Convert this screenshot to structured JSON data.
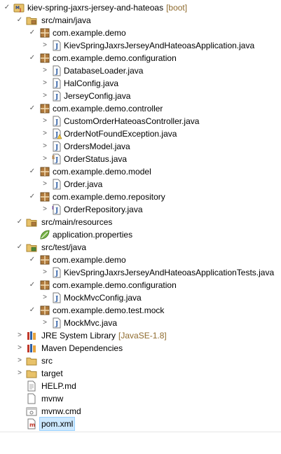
{
  "explorer": {
    "project_name": "kiev-spring-jaxrs-jersey-and-hateoas",
    "project_decoration": "[boot]",
    "src_main_java": "src/main/java",
    "pkg_demo": "com.example.demo",
    "file_app": "KievSpringJaxrsJerseyAndHateoasApplication.java",
    "pkg_configuration": "com.example.demo.configuration",
    "file_database_loader": "DatabaseLoader.java",
    "file_hal_config": "HalConfig.java",
    "file_jersey_config": "JerseyConfig.java",
    "pkg_controller": "com.example.demo.controller",
    "file_custom_controller": "CustomOrderHateoasController.java",
    "file_not_found_exception": "OrderNotFoundException.java",
    "file_orders_model": "OrdersModel.java",
    "file_order_status": "OrderStatus.java",
    "pkg_model": "com.example.demo.model",
    "file_order": "Order.java",
    "pkg_repository": "com.example.demo.repository",
    "file_order_repository": "OrderRepository.java",
    "src_main_resources": "src/main/resources",
    "file_app_properties": "application.properties",
    "src_test_java": "src/test/java",
    "test_pkg_demo": "com.example.demo",
    "file_app_tests": "KievSpringJaxrsJerseyAndHateoasApplicationTests.java",
    "test_pkg_configuration": "com.example.demo.configuration",
    "file_mockmvc_config": "MockMvcConfig.java",
    "test_pkg_mock": "com.example.demo.test.mock",
    "file_mockmvc": "MockMvc.java",
    "jre_library": "JRE System Library",
    "jre_decoration": "[JavaSE-1.8]",
    "maven_deps": "Maven Dependencies",
    "folder_src": "src",
    "folder_target": "target",
    "file_help": "HELP.md",
    "file_mvnw": "mvnw",
    "file_mvnw_cmd": "mvnw.cmd",
    "file_pom": "pom.xml"
  },
  "colors": {
    "selection": "#cce8ff",
    "decoration": "#8f6b2e",
    "package_icon": "#b07a3c",
    "folder_icon": "#e8c26a",
    "java_file_icon": "#2f5fa6"
  }
}
